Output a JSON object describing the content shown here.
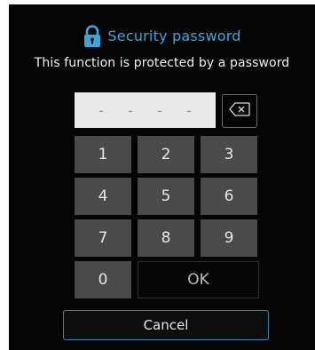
{
  "dialog": {
    "title": "Security password",
    "subtitle": "This function is protected by a password",
    "lock_icon": "lock-icon",
    "accent_color": "#3aa6dc"
  },
  "pin": {
    "placeholder_digits": [
      "-",
      "-",
      "-",
      "-"
    ]
  },
  "backspace": {
    "icon": "backspace-icon"
  },
  "keypad": {
    "keys": [
      "1",
      "2",
      "3",
      "4",
      "5",
      "6",
      "7",
      "8",
      "9",
      "0"
    ],
    "ok_label": "OK"
  },
  "cancel": {
    "label": "Cancel",
    "border_color": "#3b84ad"
  }
}
